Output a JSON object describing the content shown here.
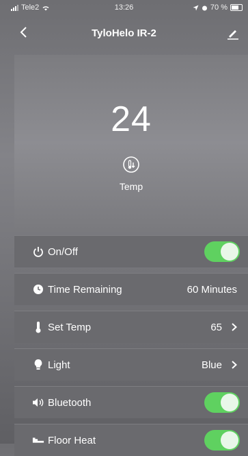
{
  "status_bar": {
    "carrier": "Tele2",
    "time": "13:26",
    "battery": "70 %"
  },
  "nav": {
    "title": "TyloHelo IR-2"
  },
  "hero": {
    "value": "24",
    "label": "Temp"
  },
  "rows": {
    "on_off": {
      "label": "On/Off",
      "toggle": true
    },
    "time_remaining": {
      "label": "Time Remaining",
      "value": "60 Minutes"
    },
    "set_temp": {
      "label": "Set Temp",
      "value": "65"
    },
    "light": {
      "label": "Light",
      "value": "Blue"
    },
    "bluetooth": {
      "label": "Bluetooth",
      "toggle": true
    },
    "floor_heat": {
      "label": "Floor Heat",
      "toggle": true
    }
  },
  "colors": {
    "toggle_on": "#5fd160"
  }
}
